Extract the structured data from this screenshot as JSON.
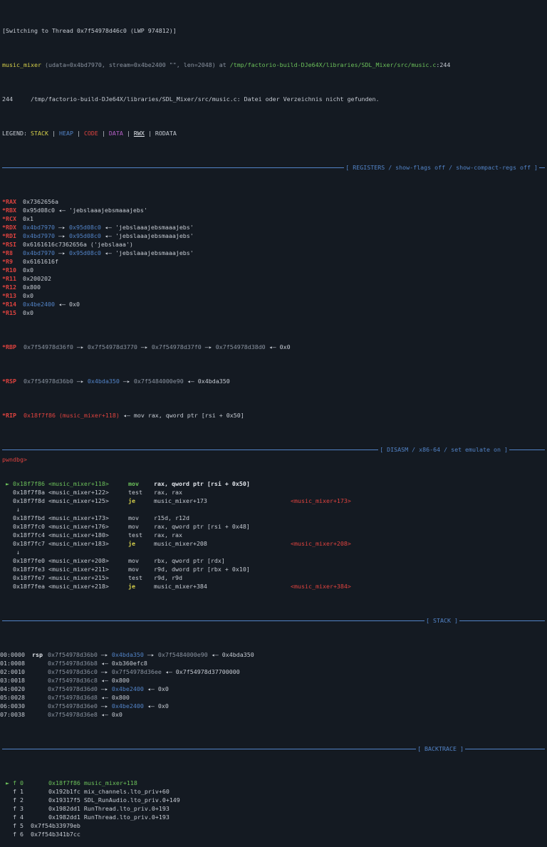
{
  "header": {
    "switch_line": "[Switching to Thread 0x7f54978d46c0 (LWP 974812)]",
    "frame_func": "music_mixer",
    "frame_args": " (udata=0x4bd7970, stream=0x4be2400 \"\", len=2048) at ",
    "frame_path": "/tmp/factorio-build-DJe64X/libraries/SDL_Mixer/src/music.c",
    "frame_line": ":244",
    "source_line": "244     /tmp/factorio-build-DJe64X/libraries/SDL_Mixer/src/music.c: Datei oder Verzeichnis nicht gefunden.",
    "legend_label": "LEGEND: ",
    "legend": {
      "stack": "STACK",
      "heap": "HEAP",
      "code": "CODE",
      "data": "DATA",
      "rwx": "RWX",
      "rodata": "RODATA"
    }
  },
  "sections": {
    "registers": "[ REGISTERS / show-flags off / show-compact-regs off ]",
    "disasm": "[ DISASM / x86-64 / set emulate on ]",
    "stack": "[ STACK ]",
    "backtrace": "[ BACKTRACE ]"
  },
  "registers": [
    {
      "name": "*RAX",
      "value": "0x7362656a",
      "rest": ""
    },
    {
      "name": "*RBX",
      "value": "0x95d08c0",
      "rest": " ◂— 'jebslaaajebsmaaajebs'"
    },
    {
      "name": "*RCX",
      "value": "0x1",
      "rest": ""
    },
    {
      "name": "*RDX",
      "value": "0x4bd7970",
      "arrow": " —▸ ",
      "value2": "0x95d08c0",
      "rest": " ◂— 'jebslaaajebsmaaajebs'"
    },
    {
      "name": "*RDI",
      "value": "0x4bd7970",
      "arrow": " —▸ ",
      "value2": "0x95d08c0",
      "rest": " ◂— 'jebslaaajebsmaaajebs'"
    },
    {
      "name": "*RSI",
      "value": "0x6161616c7362656a ('jebslaaa')",
      "rest": ""
    },
    {
      "name": "*R8",
      "value": "0x4bd7970",
      "arrow": " —▸ ",
      "value2": "0x95d08c0",
      "rest": " ◂— 'jebslaaajebsmaaajebs'"
    },
    {
      "name": "*R9",
      "value": "0x6161616f",
      "rest": ""
    },
    {
      "name": "*R10",
      "value": "0x0",
      "rest": ""
    },
    {
      "name": "*R11",
      "value": "0x200202",
      "rest": ""
    },
    {
      "name": "*R12",
      "value": "0x800",
      "rest": ""
    },
    {
      "name": "*R13",
      "value": "0x0",
      "rest": ""
    },
    {
      "name": "*R14",
      "value": "0x4be2400",
      "rest": " ◂— 0x0"
    },
    {
      "name": "*R15",
      "value": "0x0",
      "rest": ""
    }
  ],
  "rbp": {
    "name": "*RBP",
    "a": "0x7f54978d36f0",
    "b": "0x7f54978d3770",
    "c": "0x7f54978d37f0",
    "d": "0x7f54978d38d0",
    "tail": " ◂— 0x0"
  },
  "rsp": {
    "name": "*RSP",
    "a": "0x7f54978d36b0",
    "b": "0x4bda350",
    "c": "0x7f5484000e90",
    "tail": " ◂— 0x4bda350"
  },
  "rip": {
    "name": "*RIP",
    "a": "0x18f7f86 (music_mixer+118)",
    "tail": " ◂— mov rax, qword ptr [rsi + 0x50]"
  },
  "disasm": [
    {
      "marker": " ► ",
      "addr": "0x18f7f86",
      "sym": " <music_mixer+118>",
      "mn": "mov",
      "ops": "rax, qword ptr [rsi + 0x50]",
      "target": "",
      "current": true
    },
    {
      "marker": "   ",
      "addr": "0x18f7f8a",
      "sym": " <music_mixer+122>",
      "mn": "test",
      "ops": "rax, rax",
      "target": ""
    },
    {
      "marker": "   ",
      "addr": "0x18f7f8d",
      "sym": " <music_mixer+125>",
      "mn": "je",
      "ops": "music_mixer+173",
      "target": "<music_mixer+173>",
      "jump": true
    },
    {
      "marker": "    ↓",
      "addr": "",
      "sym": "",
      "mn": "",
      "ops": "",
      "target": "",
      "arrow": true
    },
    {
      "marker": "   ",
      "addr": "0x18f7fbd",
      "sym": " <music_mixer+173>",
      "mn": "mov",
      "ops": "r15d, r12d",
      "target": ""
    },
    {
      "marker": "   ",
      "addr": "0x18f7fc0",
      "sym": " <music_mixer+176>",
      "mn": "mov",
      "ops": "rax, qword ptr [rsi + 0x48]",
      "target": ""
    },
    {
      "marker": "   ",
      "addr": "0x18f7fc4",
      "sym": " <music_mixer+180>",
      "mn": "test",
      "ops": "rax, rax",
      "target": ""
    },
    {
      "marker": "   ",
      "addr": "0x18f7fc7",
      "sym": " <music_mixer+183>",
      "mn": "je",
      "ops": "music_mixer+208",
      "target": "<music_mixer+208>",
      "jump": true
    },
    {
      "marker": "    ↓",
      "addr": "",
      "sym": "",
      "mn": "",
      "ops": "",
      "target": "",
      "arrow": true
    },
    {
      "marker": "   ",
      "addr": "0x18f7fe0",
      "sym": " <music_mixer+208>",
      "mn": "mov",
      "ops": "rbx, qword ptr [rdx]",
      "target": ""
    },
    {
      "marker": "   ",
      "addr": "0x18f7fe3",
      "sym": " <music_mixer+211>",
      "mn": "mov",
      "ops": "r9d, dword ptr [rbx + 0x10]",
      "target": ""
    },
    {
      "marker": "   ",
      "addr": "0x18f7fe7",
      "sym": " <music_mixer+215>",
      "mn": "test",
      "ops": "r9d, r9d",
      "target": ""
    },
    {
      "marker": "   ",
      "addr": "0x18f7fea",
      "sym": " <music_mixer+218>",
      "mn": "je",
      "ops": "music_mixer+384",
      "target": "<music_mixer+384>",
      "jump": true
    }
  ],
  "stack": [
    {
      "off": "00:0000",
      "reg": "rsp",
      "addr": "0x7f54978d36b0",
      "arrow": " —▸ ",
      "p1": "0x4bda350",
      "arrow2": " —▸ ",
      "p2": "0x7f5484000e90",
      "tail": " ◂— 0x4bda350"
    },
    {
      "off": "01:0008",
      "reg": "",
      "addr": "0x7f54978d36b8",
      "arrow": "",
      "p1": "",
      "arrow2": "",
      "p2": "",
      "tail": " ◂— 0xb360efc8"
    },
    {
      "off": "02:0010",
      "reg": "",
      "addr": "0x7f54978d36c0",
      "arrow": " —▸ ",
      "p1": "0x7f54978d36ee",
      "arrow2": "",
      "p2": "",
      "tail": " ◂— 0x7f54978d37700000"
    },
    {
      "off": "03:0018",
      "reg": "",
      "addr": "0x7f54978d36c8",
      "arrow": "",
      "p1": "",
      "arrow2": "",
      "p2": "",
      "tail": " ◂— 0x800"
    },
    {
      "off": "04:0020",
      "reg": "",
      "addr": "0x7f54978d36d0",
      "arrow": " —▸ ",
      "p1": "0x4be2400",
      "arrow2": "",
      "p2": "",
      "tail": " ◂— 0x0"
    },
    {
      "off": "05:0028",
      "reg": "",
      "addr": "0x7f54978d36d8",
      "arrow": "",
      "p1": "",
      "arrow2": "",
      "p2": "",
      "tail": " ◂— 0x800"
    },
    {
      "off": "06:0030",
      "reg": "",
      "addr": "0x7f54978d36e0",
      "arrow": " —▸ ",
      "p1": "0x4be2400",
      "arrow2": "",
      "p2": "",
      "tail": " ◂— 0x0"
    },
    {
      "off": "07:0038",
      "reg": "",
      "addr": "0x7f54978d36e8",
      "arrow": "",
      "p1": "",
      "arrow2": "",
      "p2": "",
      "tail": " ◂— 0x0"
    }
  ],
  "backtrace": [
    {
      "marker": " ► ",
      "frame": "f 0",
      "addr": "       0x18f7f86",
      "name": " music_mixer+118"
    },
    {
      "marker": "   ",
      "frame": "f 1",
      "addr": "       0x192b1fc",
      "name": " mix_channels.lto_priv+60"
    },
    {
      "marker": "   ",
      "frame": "f 2",
      "addr": "       0x19317f5",
      "name": " SDL_RunAudio.lto_priv.0+149"
    },
    {
      "marker": "   ",
      "frame": "f 3",
      "addr": "       0x1982dd1",
      "name": " RunThread.lto_priv.0+193"
    },
    {
      "marker": "   ",
      "frame": "f 4",
      "addr": "       0x1982dd1",
      "name": " RunThread.lto_priv.0+193"
    },
    {
      "marker": "   ",
      "frame": "f 5",
      "addr": "  0x7f54b33979eb",
      "name": ""
    },
    {
      "marker": "   ",
      "frame": "f 6",
      "addr": "  0x7f54b341b7cc",
      "name": ""
    }
  ],
  "prompt": "pwndbg>"
}
